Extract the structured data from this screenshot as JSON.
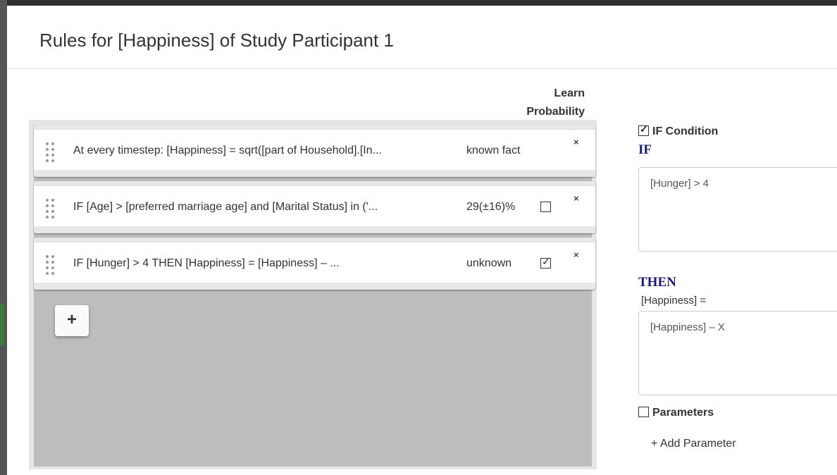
{
  "modal": {
    "title": "Rules for [Happiness] of Study Participant 1"
  },
  "header": {
    "learn_probability_line1": "Learn",
    "learn_probability_line2": "Probability"
  },
  "rules": [
    {
      "text": "At every timestep: [Happiness] = sqrt([part of Household].[In...",
      "status": "known fact",
      "has_checkbox": false,
      "checked": false
    },
    {
      "text": "IF [Age] > [preferred marriage age] and [Marital Status] in ('...",
      "status": "29(±16)%",
      "has_checkbox": true,
      "checked": false
    },
    {
      "text": "IF [Hunger] > 4 THEN [Happiness] = [Happiness] – ...",
      "status": "unknown",
      "has_checkbox": true,
      "checked": true
    }
  ],
  "close_label": "×",
  "add_rule_label": "+",
  "editor": {
    "if_condition_label": "IF Condition",
    "if_condition_checked": true,
    "if_keyword": "IF",
    "if_value": "[Hunger] > 4",
    "then_keyword": "THEN",
    "then_prefix": "[Happiness] =",
    "then_value": "[Happiness] – X",
    "parameters_label": "Parameters",
    "parameters_checked": false,
    "add_parameter_label": "+ Add Parameter"
  }
}
